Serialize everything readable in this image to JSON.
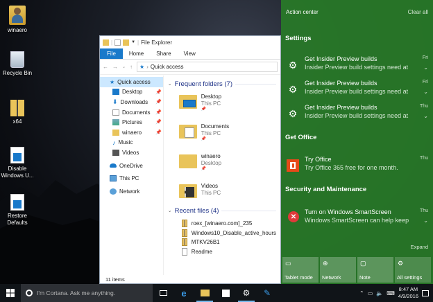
{
  "desktop": {
    "icons": [
      {
        "label": "winaero"
      },
      {
        "label": "Recycle Bin"
      },
      {
        "label": "x64"
      },
      {
        "label": "Disable Windows U..."
      },
      {
        "label": "Restore Defaults"
      }
    ]
  },
  "explorer": {
    "title": "File Explorer",
    "ribbon_tabs": [
      "File",
      "Home",
      "Share",
      "View"
    ],
    "address": "Quick access",
    "nav": [
      {
        "label": "Quick access",
        "icon": "star-icon",
        "selected": true
      },
      {
        "label": "Desktop",
        "icon": "desktop-icon",
        "pinned": true
      },
      {
        "label": "Downloads",
        "icon": "download-icon",
        "pinned": true
      },
      {
        "label": "Documents",
        "icon": "document-icon",
        "pinned": true
      },
      {
        "label": "Pictures",
        "icon": "pictures-icon",
        "pinned": true
      },
      {
        "label": "winaero",
        "icon": "folder-icon",
        "pinned": true
      },
      {
        "label": "Music",
        "icon": "music-icon"
      },
      {
        "label": "Videos",
        "icon": "video-icon"
      },
      {
        "label": "OneDrive",
        "icon": "cloud-icon"
      },
      {
        "label": "This PC",
        "icon": "computer-icon"
      },
      {
        "label": "Network",
        "icon": "network-icon"
      }
    ],
    "frequent_header": "Frequent folders (7)",
    "frequent": [
      {
        "name": "Desktop",
        "location": "This PC"
      },
      {
        "name": "Documents",
        "location": "This PC"
      },
      {
        "name": "winaero",
        "location": "Desktop"
      },
      {
        "name": "Videos",
        "location": "This PC"
      }
    ],
    "recent_header": "Recent files (4)",
    "recent": [
      {
        "name": "roex_[winaero.com]_235"
      },
      {
        "name": "Windows10_Disable_active_hours"
      },
      {
        "name": "MTKV26B1"
      },
      {
        "name": "Readme"
      }
    ],
    "status": "11 items"
  },
  "action_center": {
    "title": "Action center",
    "clear_all": "Clear all",
    "groups": [
      {
        "name": "Settings"
      },
      {
        "name": "Get Office"
      },
      {
        "name": "Security and Maintenance"
      }
    ],
    "notifications": [
      {
        "title": "Get Insider Preview builds",
        "body": "Insider Preview build settings need at",
        "day": "Fri"
      },
      {
        "title": "Get Insider Preview builds",
        "body": "Insider Preview build settings need at",
        "day": "Fri"
      },
      {
        "title": "Get Insider Preview builds",
        "body": "Insider Preview build settings need at",
        "day": "Thu"
      },
      {
        "title": "Try Office",
        "body": "Try Office 365 free for one month.",
        "day": "Thu"
      },
      {
        "title": "Turn on Windows SmartScreen",
        "body": "Windows SmartScreen can help keep",
        "day": "Thu"
      }
    ],
    "expand": "Expand",
    "quick_actions": [
      {
        "label": "Tablet mode",
        "icon": "tablet-icon"
      },
      {
        "label": "Network",
        "icon": "globe-icon"
      },
      {
        "label": "Note",
        "icon": "note-icon"
      },
      {
        "label": "All settings",
        "icon": "gear-icon"
      }
    ],
    "colors": {
      "accent": "#2d7a2d"
    }
  },
  "taskbar": {
    "cortana_placeholder": "I'm Cortana. Ask me anything.",
    "time": "8:47 AM",
    "date": "4/9/2016"
  }
}
